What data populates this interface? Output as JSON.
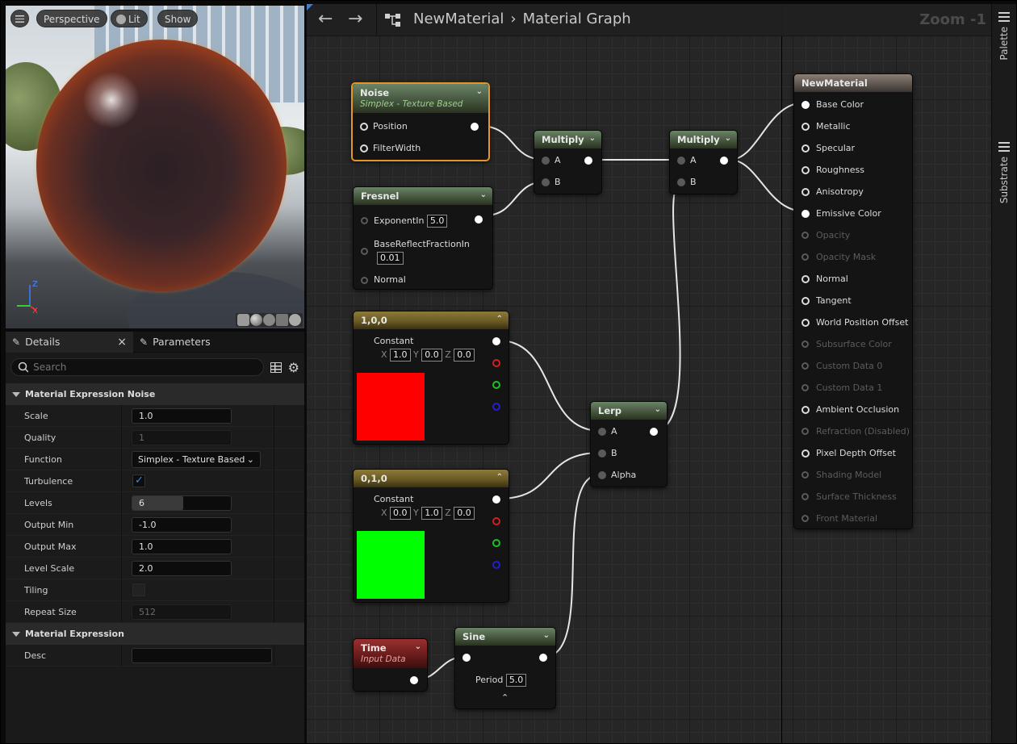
{
  "viewport": {
    "menu_icon": "hamburger-icon",
    "perspective_label": "Perspective",
    "lit_label": "Lit",
    "show_label": "Show",
    "axis_z": "Z",
    "axis_x": "X"
  },
  "details": {
    "tab_details": "Details",
    "tab_close": "×",
    "tab_parameters": "Parameters",
    "search_placeholder": "Search",
    "section1": "Material Expression Noise",
    "section2": "Material Expression",
    "props": {
      "scale": {
        "label": "Scale",
        "value": "1.0"
      },
      "quality": {
        "label": "Quality",
        "value": "1"
      },
      "function": {
        "label": "Function",
        "value": "Simplex - Texture Based"
      },
      "turbulence": {
        "label": "Turbulence",
        "checked": true
      },
      "levels": {
        "label": "Levels",
        "value": "6",
        "fill_fraction": 0.52
      },
      "output_min": {
        "label": "Output Min",
        "value": "-1.0"
      },
      "output_max": {
        "label": "Output Max",
        "value": "1.0"
      },
      "level_scale": {
        "label": "Level Scale",
        "value": "2.0"
      },
      "tiling": {
        "label": "Tiling",
        "checked": false
      },
      "repeat_size": {
        "label": "Repeat Size",
        "value": "512"
      },
      "desc": {
        "label": "Desc",
        "value": ""
      }
    }
  },
  "graph": {
    "breadcrumb_root": "NewMaterial",
    "breadcrumb_sep": "›",
    "breadcrumb_leaf": "Material Graph",
    "zoom": "Zoom -1",
    "nodes": {
      "noise": {
        "title": "Noise",
        "subtitle": "Simplex - Texture Based",
        "pins": [
          "Position",
          "FilterWidth"
        ]
      },
      "fresnel": {
        "title": "Fresnel",
        "exponent_label": "ExponentIn",
        "exponent_value": "5.0",
        "brf_label": "BaseReflectFractionIn",
        "brf_value": "0.01",
        "normal_label": "Normal"
      },
      "multiply1": {
        "title": "Multiply",
        "a": "A",
        "b": "B"
      },
      "multiply2": {
        "title": "Multiply",
        "a": "A",
        "b": "B"
      },
      "const_red": {
        "title": "1,0,0",
        "label": "Constant",
        "x": "1.0",
        "y": "0.0",
        "z": "0.0",
        "color": "#ff0000"
      },
      "const_green": {
        "title": "0,1,0",
        "label": "Constant",
        "x": "0.0",
        "y": "1.0",
        "z": "0.0",
        "color": "#00ff00"
      },
      "lerp": {
        "title": "Lerp",
        "a": "A",
        "b": "B",
        "alpha": "Alpha"
      },
      "time": {
        "title": "Time",
        "subtitle": "Input Data"
      },
      "sine": {
        "title": "Sine",
        "period_label": "Period",
        "period_value": "5.0"
      },
      "material": {
        "title": "NewMaterial",
        "inputs": [
          {
            "label": "Base Color",
            "enabled": true
          },
          {
            "label": "Metallic",
            "enabled": true
          },
          {
            "label": "Specular",
            "enabled": true
          },
          {
            "label": "Roughness",
            "enabled": true
          },
          {
            "label": "Anisotropy",
            "enabled": true
          },
          {
            "label": "Emissive Color",
            "enabled": true
          },
          {
            "label": "Opacity",
            "enabled": false
          },
          {
            "label": "Opacity Mask",
            "enabled": false
          },
          {
            "label": "Normal",
            "enabled": true
          },
          {
            "label": "Tangent",
            "enabled": true
          },
          {
            "label": "World Position Offset",
            "enabled": true
          },
          {
            "label": "Subsurface Color",
            "enabled": false
          },
          {
            "label": "Custom Data 0",
            "enabled": false
          },
          {
            "label": "Custom Data 1",
            "enabled": false
          },
          {
            "label": "Ambient Occlusion",
            "enabled": true
          },
          {
            "label": "Refraction (Disabled)",
            "enabled": false
          },
          {
            "label": "Pixel Depth Offset",
            "enabled": true
          },
          {
            "label": "Shading Model",
            "enabled": false
          },
          {
            "label": "Surface Thickness",
            "enabled": false
          },
          {
            "label": "Front Material",
            "enabled": false
          }
        ]
      }
    }
  },
  "sidebar": {
    "palette_label": "Palette",
    "substrate_label": "Substrate"
  }
}
